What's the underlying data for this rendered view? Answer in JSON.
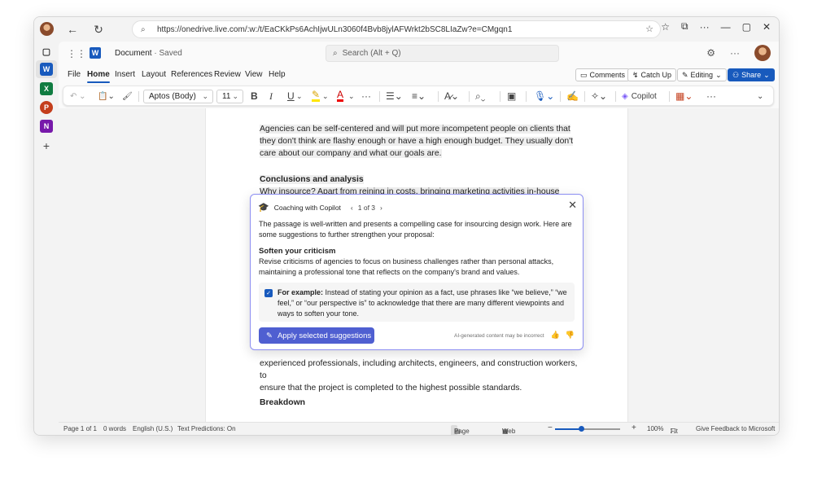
{
  "browser": {
    "url": "https://onedrive.live.com/:w:/t/EaCKkPs6AchIjwULn3060f4Bvb8jylAFWrkt2bSC8LIaZw?e=CMgqn1"
  },
  "app": {
    "doc_name": "Document",
    "saved_state": "· Saved",
    "search_placeholder": "Search (Alt + Q)"
  },
  "ribbon_tabs": [
    "File",
    "Home",
    "Insert",
    "Layout",
    "References",
    "Review",
    "View",
    "Help"
  ],
  "ribbon_right": {
    "comments": "Comments",
    "catch_up": "Catch Up",
    "editing": "Editing",
    "share": "Share"
  },
  "toolbar": {
    "font": "Aptos (Body)",
    "size": "11",
    "bold": "B",
    "italic": "I",
    "underline": "U",
    "font_color": "A",
    "copilot": "Copilot"
  },
  "document": {
    "para1": "Agencies can be self-centered and will put more incompetent people on clients that they don't think are flashy enough or have a high enough budget. They usually don't care about our company and what our goals are.",
    "heading1": "Conclusions and analysis",
    "para2": "Why insource? Apart from reining in costs, bringing marketing activities in-house helps companies accelerate their marketing output and generally gain greater control.",
    "para3a": "experienced professionals, including architects, engineers, and construction workers, to",
    "para3b": "ensure that the project is completed to the highest possible standards.",
    "heading2": "Breakdown"
  },
  "copilot_card": {
    "title": "Coaching with Copilot",
    "pager": "1 of 3",
    "intro": "The passage is well-written and presents a compelling case for insourcing design work. Here are some suggestions to further strengthen your proposal:",
    "suggestion_title": "Soften your criticism",
    "suggestion_body": "Revise criticisms of agencies to focus on business challenges rather than personal attacks, maintaining a professional tone that reflects on the company's brand and values.",
    "example_label": "For example:",
    "example_text": " Instead of stating your opinion as a fact, use phrases like “we believe,” “we feel,” or “our perspective is” to acknowledge that there are many different viewpoints and ways to soften your tone.",
    "apply_label": "Apply selected suggestions",
    "disclaimer": "AI-generated content may be incorrect"
  },
  "status": {
    "page": "Page 1 of 1",
    "words": "0 words",
    "language": "English (U.S.)",
    "predictions": "Text Predictions: On",
    "page_view": "Page View",
    "web_view": "Web View",
    "zoom": "100%",
    "zoom_fraction": 0.4,
    "fit": "Fit",
    "feedback": "Give Feedback to Microsoft"
  },
  "colors": {
    "accent": "#185abd",
    "copilot_accent": "#4f5fd1"
  }
}
